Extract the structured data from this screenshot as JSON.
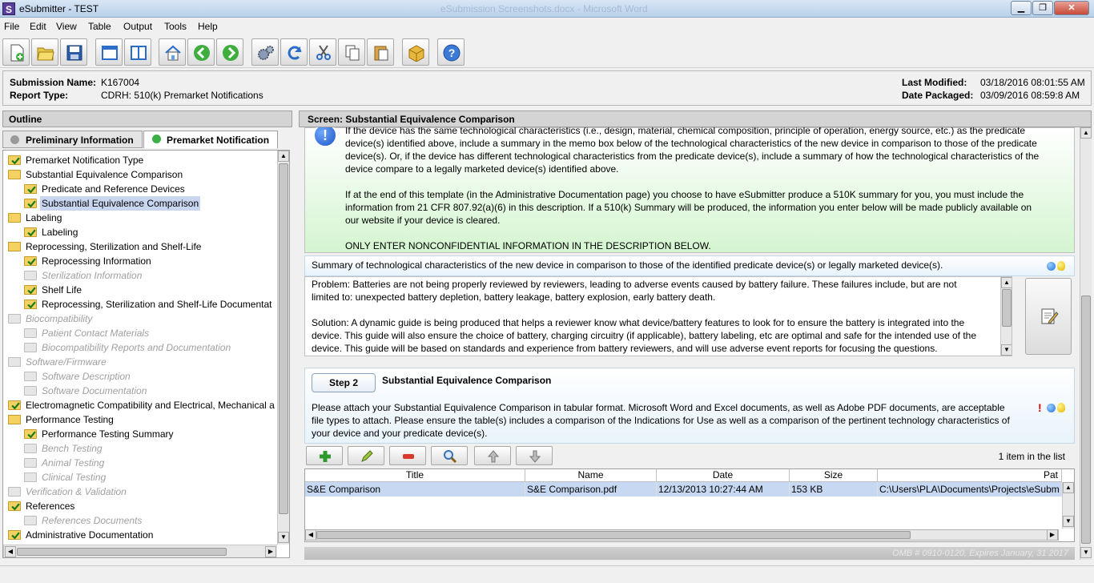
{
  "window": {
    "title": "eSubmitter - TEST",
    "icon_letter": "S",
    "background_title": "eSubmission Screenshots.docx - Microsoft Word"
  },
  "menu": [
    "File",
    "Edit",
    "View",
    "Table",
    "Output",
    "Tools",
    "Help"
  ],
  "toolbar": {
    "icons": [
      "new-document-icon",
      "open-folder-icon",
      "save-icon",
      "window-icon",
      "split-window-icon",
      "home-icon",
      "back-arrow-icon",
      "forward-arrow-icon",
      "settings-gears-icon",
      "refresh-icon",
      "cut-icon",
      "copy-icon",
      "paste-icon",
      "package-icon",
      "help-icon"
    ]
  },
  "submission": {
    "name_label": "Submission Name:",
    "name": "K167004",
    "type_label": "Report Type:",
    "type": "CDRH: 510(k) Premarket Notifications",
    "modified_label": "Last Modified:",
    "modified": "03/18/2016 08:01:55 AM",
    "packaged_label": "Date Packaged:",
    "packaged": "03/09/2016 08:59:8 AM"
  },
  "outline": {
    "heading": "Outline",
    "tabs": [
      {
        "label": "Preliminary Information",
        "color": "#9a9a9a"
      },
      {
        "label": "Premarket Notification",
        "color": "#3cb043"
      }
    ],
    "tree": [
      {
        "label": "Premarket Notification Type",
        "level": 0,
        "icon": "folder-check",
        "enabled": true
      },
      {
        "label": "Substantial Equivalence Comparison",
        "level": 0,
        "icon": "folder",
        "enabled": true
      },
      {
        "label": "Predicate and Reference Devices",
        "level": 1,
        "icon": "folder-check",
        "enabled": true
      },
      {
        "label": "Substantial Equivalence Comparison",
        "level": 1,
        "icon": "folder-check",
        "enabled": true,
        "selected": true
      },
      {
        "label": "Labeling",
        "level": 0,
        "icon": "folder",
        "enabled": true
      },
      {
        "label": "Labeling",
        "level": 1,
        "icon": "folder-check",
        "enabled": true
      },
      {
        "label": "Reprocessing, Sterilization and Shelf-Life",
        "level": 0,
        "icon": "folder",
        "enabled": true
      },
      {
        "label": "Reprocessing Information",
        "level": 1,
        "icon": "folder-check",
        "enabled": true
      },
      {
        "label": "Sterilization Information",
        "level": 1,
        "icon": "folder",
        "enabled": false
      },
      {
        "label": "Shelf Life",
        "level": 1,
        "icon": "folder-check",
        "enabled": true
      },
      {
        "label": "Reprocessing, Sterilization and Shelf-Life Documentat",
        "level": 1,
        "icon": "folder-check",
        "enabled": true
      },
      {
        "label": "Biocompatibility",
        "level": 0,
        "icon": "folder",
        "enabled": false
      },
      {
        "label": "Patient Contact Materials",
        "level": 1,
        "icon": "folder",
        "enabled": false
      },
      {
        "label": "Biocompatibility Reports and Documentation",
        "level": 1,
        "icon": "folder",
        "enabled": false
      },
      {
        "label": "Software/Firmware",
        "level": 0,
        "icon": "folder",
        "enabled": false
      },
      {
        "label": "Software Description",
        "level": 1,
        "icon": "folder",
        "enabled": false
      },
      {
        "label": "Software Documentation",
        "level": 1,
        "icon": "folder",
        "enabled": false
      },
      {
        "label": "Electromagnetic Compatibility and Electrical, Mechanical a",
        "level": 0,
        "icon": "folder-check",
        "enabled": true
      },
      {
        "label": "Performance Testing",
        "level": 0,
        "icon": "folder",
        "enabled": true
      },
      {
        "label": "Performance Testing Summary",
        "level": 1,
        "icon": "folder-check",
        "enabled": true
      },
      {
        "label": "Bench Testing",
        "level": 1,
        "icon": "folder",
        "enabled": false
      },
      {
        "label": "Animal Testing",
        "level": 1,
        "icon": "folder",
        "enabled": false
      },
      {
        "label": "Clinical Testing",
        "level": 1,
        "icon": "folder",
        "enabled": false
      },
      {
        "label": "Verification & Validation",
        "level": 0,
        "icon": "folder",
        "enabled": false
      },
      {
        "label": "References",
        "level": 0,
        "icon": "folder-check",
        "enabled": true
      },
      {
        "label": "References Documents",
        "level": 1,
        "icon": "folder",
        "enabled": false
      },
      {
        "label": "Administrative Documentation",
        "level": 0,
        "icon": "folder-check",
        "enabled": true
      }
    ]
  },
  "screen": {
    "heading": "Screen: Substantial Equivalence Comparison",
    "note": {
      "p1_line0": "If the device has the same technological characteristics (i.e., design, material, chemical composition, principle of operation, energy source, etc.) as the predicate",
      "p1_line1": "device(s) identified above, include a summary in the memo box below of the technological characteristics of the new device in comparison to those of the predicate",
      "p1_line2": "device(s). Or, if the device has different technological characteristics from the predicate device(s), include a summary of how the technological characteristics of the",
      "p1_line3": "device compare to a legally marketed device(s) identified above.",
      "p2_line0": "If at the end of this template (in the Administrative Documentation page) you choose to have eSubmitter produce a 510K summary for you, you must include the",
      "p2_line1": "information from 21 CFR 807.92(a)(6) in this description. If a 510(k) Summary will be produced,  the information you enter below will be made publicly available on",
      "p2_line2": "our website if your device is cleared.",
      "p3": "ONLY ENTER NONCONFIDENTIAL INFORMATION IN THE DESCRIPTION BELOW."
    },
    "summary_prompt": "Summary of technological characteristics of the new device in comparison to those of the identified predicate device(s) or legally marketed device(s).",
    "description": {
      "line0": "Problem:  Batteries are not being properly reviewed by reviewers, leading to adverse events caused by battery failure.  These failures include, but are not",
      "line1": "limited to:  unexpected battery depletion, battery leakage, battery explosion, early battery death.",
      "line2": "Solution:  A dynamic guide is being produced that helps a reviewer know what device/battery features to look for to ensure the battery is integrated into the",
      "line3": "device.  This guide will also ensure the choice of battery, charging circuitry (if applicable), battery labeling, etc are optimal and safe for the intended use of the",
      "line4": "device.  This guide will be based on standards and experience from battery reviewers, and will use adverse event reports for focusing the questions."
    },
    "step": {
      "button": "Step 2",
      "title": "Substantial Equivalence Comparison",
      "line0": "Please attach your Substantial Equivalence Comparison in tabular format.  Microsoft Word and Excel documents, as well as Adobe PDF documents, are acceptable",
      "line1": "file types to attach.  Please ensure the table(s) includes a comparison of the Indications for Use as well as a comparison of the pertinent technology characteristics of",
      "line2": "your device and your predicate device(s).",
      "exclaim": "!"
    },
    "attachments": {
      "count_text": "1 item in the list",
      "columns": [
        "Title",
        "Name",
        "Date",
        "Size",
        "Pat"
      ],
      "rows": [
        {
          "title": "S&E Comparison",
          "name": "S&E Comparison.pdf",
          "date": "12/13/2013 10:27:44 AM",
          "size": "153 KB",
          "path": "C:\\Users\\PLA\\Documents\\Projects\\eSubm"
        }
      ]
    },
    "omb": "OMB # 0910-0120, Expires January, 31 2017"
  }
}
